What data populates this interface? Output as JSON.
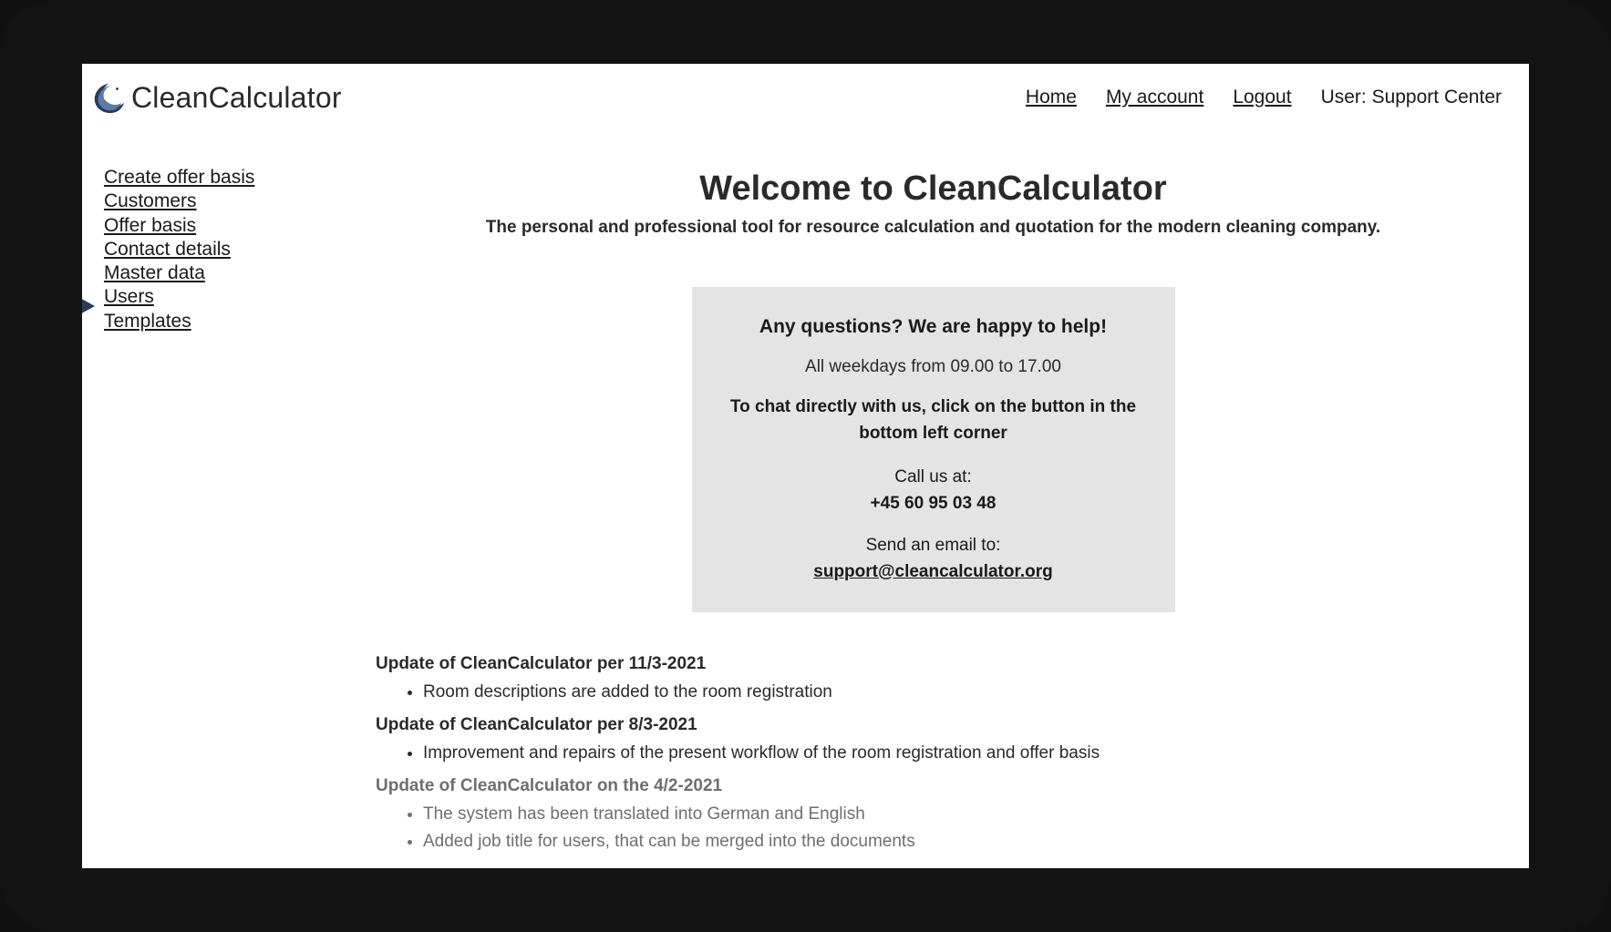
{
  "brand": {
    "name": "CleanCalculator"
  },
  "topnav": {
    "home": "Home",
    "account": "My account",
    "logout": "Logout",
    "user_label": "User: Support Center"
  },
  "sidebar": {
    "items": [
      "Create offer basis",
      "Customers",
      "Offer basis",
      "Contact details",
      "Master data",
      "Users",
      "Templates"
    ]
  },
  "main": {
    "title": "Welcome to CleanCalculator",
    "subtitle": "The personal and professional tool for resource calculation and quotation for the modern cleaning company."
  },
  "help": {
    "q": "Any questions? We are happy to help!",
    "hours": "All weekdays from 09.00 to 17.00",
    "chat": "To chat directly with us, click on the button in the bottom left corner",
    "call_label": "Call us at:",
    "phone": "+45 60 95 03 48",
    "email_label": "Send an email to:",
    "email": "support@cleancalculator.org"
  },
  "updates": [
    {
      "title": "Update of CleanCalculator per 11/3-2021",
      "dim": false,
      "items": [
        "Room descriptions are added to the room registration"
      ]
    },
    {
      "title": "Update of CleanCalculator per 8/3-2021",
      "dim": false,
      "items": [
        "Improvement and repairs of the present workflow of the room registration and offer basis"
      ]
    },
    {
      "title": "Update of CleanCalculator on the 4/2-2021",
      "dim": true,
      "items": [
        "The system has been translated into German and English",
        "Added job title for users, that can be merged into the documents"
      ]
    }
  ]
}
